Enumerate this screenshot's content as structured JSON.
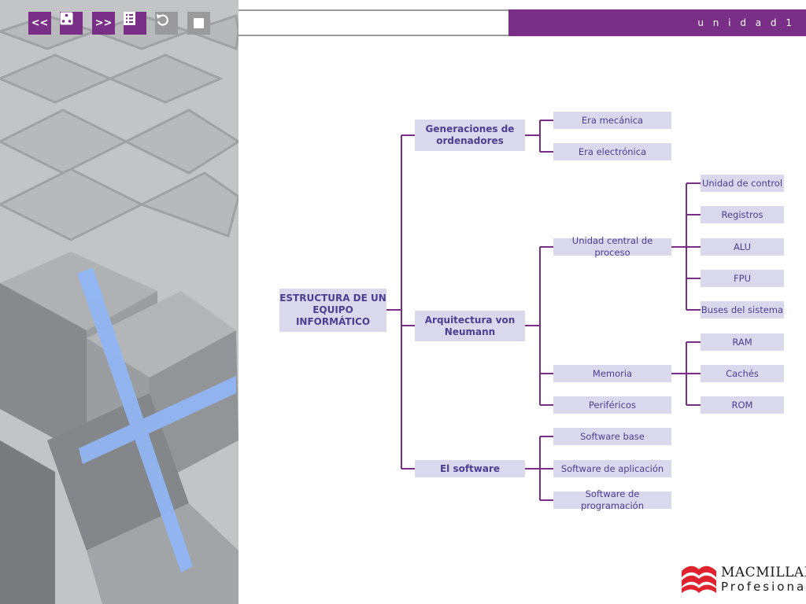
{
  "toolbar": {
    "prev_label": "<<",
    "next_label": ">>",
    "buttons": [
      "back-button",
      "dice-button",
      "forward-button",
      "index-button",
      "undo-button",
      "stop-button"
    ]
  },
  "header": {
    "unit_label": "u n i d a d   1"
  },
  "diagram": {
    "root": "ESTRUCTURA DE UN EQUIPO INFORMÁTICO",
    "branch_generaciones": "Generaciones de ordenadores",
    "branch_arquitectura": "Arquitectura von Neumann",
    "branch_software": "El software",
    "era_mecanica": "Era mecánica",
    "era_electronica": "Era electrónica",
    "ucp": "Unidad central de proceso",
    "memoria": "Memoria",
    "perifericos": "Periféricos",
    "unidad_control": "Unidad de control",
    "registros": "Registros",
    "alu": "ALU",
    "fpu": "FPU",
    "buses": "Buses del sistema",
    "ram": "RAM",
    "caches": "Cachés",
    "rom": "ROM",
    "software_base": "Software base",
    "software_aplicacion": "Software de aplicación",
    "software_programacion": "Software de programación"
  },
  "logo": {
    "name": "MACMILLAN",
    "sub": "Profesional"
  },
  "colors": {
    "accent": "#7a2f86",
    "node_fill": "#dad8ec",
    "node_text": "#4a3f91",
    "connector": "#7a2f86"
  }
}
